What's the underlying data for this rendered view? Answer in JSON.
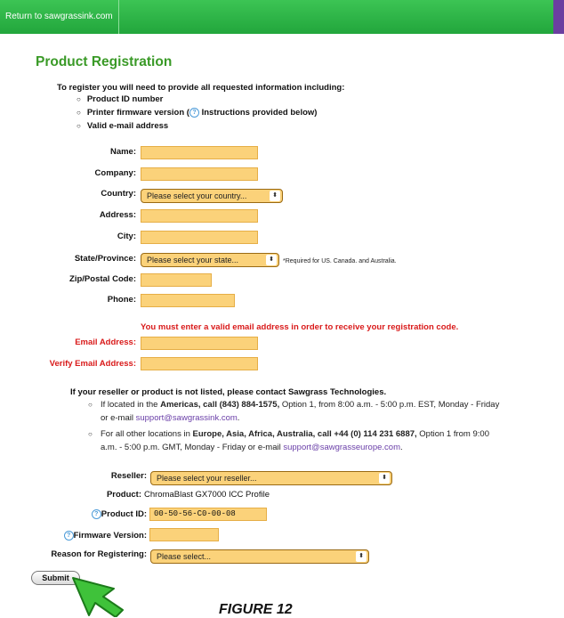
{
  "topbar": {
    "return_label": "Return to sawgrassink.com"
  },
  "page": {
    "title": "Product Registration"
  },
  "intro": {
    "text": "To register you will need to provide all requested information including:",
    "items": [
      "Product ID number",
      "Printer firmware version (",
      "Valid e-mail address"
    ],
    "firmware_suffix": " Instructions provided below)"
  },
  "form": {
    "name_label": "Name:",
    "company_label": "Company:",
    "country_label": "Country:",
    "country_value": "Please select your country...",
    "address_label": "Address:",
    "city_label": "City:",
    "state_label": "State/Province:",
    "state_value": "Please select your state...",
    "state_note": "*Required for US. Canada. and Australia.",
    "zip_label": "Zip/Postal Code:",
    "phone_label": "Phone:",
    "email_warning": "You must enter a valid email address in order to receive your registration code.",
    "email_label": "Email Address:",
    "verify_email_label": "Verify Email Address:"
  },
  "reseller_info": {
    "note": "If your reseller or product is not listed, please contact Sawgrass Technologies.",
    "americas_a": "If located in the ",
    "americas_b": "Americas, call (843) 884-1575,",
    "americas_c": " Option 1, from 8:00 a.m. - 5:00 p.m. EST, Monday - Friday",
    "americas_d": "or e-mail ",
    "americas_email": "support@sawgrassink.com",
    "americas_end": ".",
    "others_a": "For all other locations in ",
    "others_b": "Europe, Asia, Africa, Australia, call +44 (0) 114 231 6887,",
    "others_c": " Option 1 from 9:00",
    "others_d": "a.m. - 5:00 p.m. GMT, Monday - Friday or e-mail ",
    "others_email": "support@sawgrasseurope.com",
    "others_end": "."
  },
  "product": {
    "reseller_label": "Reseller:",
    "reseller_value": "Please select your reseller...",
    "product_label": "Product:",
    "product_value": "ChromaBlast GX7000 ICC Profile",
    "product_id_label": "Product ID:",
    "product_id_value": "00-50-56-C0-00-08",
    "firmware_label": "Firmware Version:",
    "reason_label": "Reason for Registering:",
    "reason_value": "Please select..."
  },
  "submit_label": "Submit",
  "figure_caption": "FIGURE 12",
  "colors": {
    "accent_green": "#3a9a27",
    "field_orange": "#fbd27a",
    "error_red": "#d91a1a",
    "link_purple": "#6a3fa8"
  }
}
